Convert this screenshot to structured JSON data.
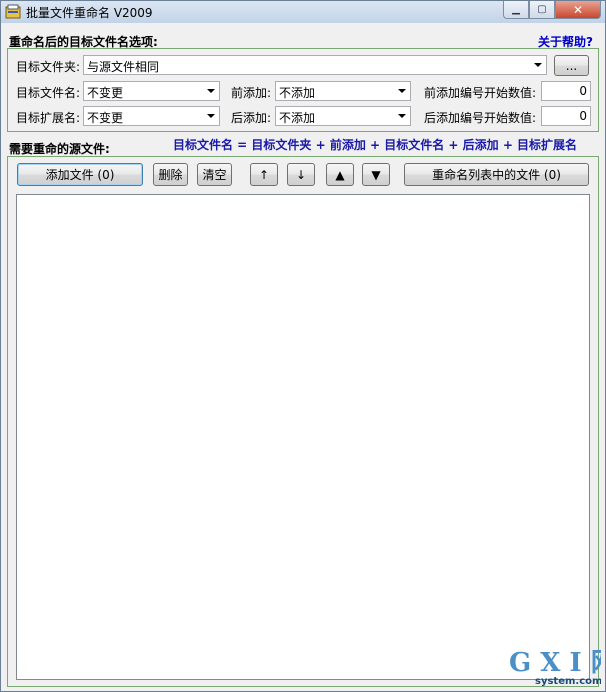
{
  "window": {
    "title": "批量文件重命名 V2009"
  },
  "options": {
    "section_title": "重命名后的目标文件名选项:",
    "help_link": "关于帮助?",
    "target_folder_label": "目标文件夹:",
    "target_folder_value": "与源文件相同",
    "browse_label": "...",
    "target_name_label": "目标文件名:",
    "target_name_value": "不变更",
    "target_ext_label": "目标扩展名:",
    "target_ext_value": "不变更",
    "prefix_label": "前添加:",
    "prefix_value": "不添加",
    "suffix_label": "后添加:",
    "suffix_value": "不添加",
    "prefix_start_label": "前添加编号开始数值:",
    "prefix_start_value": "0",
    "suffix_start_label": "后添加编号开始数值:",
    "suffix_start_value": "0"
  },
  "source": {
    "section_title": "需要重命的源文件:",
    "formula": "目标文件名 = 目标文件夹 +  前添加 + 目标文件名 + 后添加 + 目标扩展名",
    "add_files_label": "添加文件 (0)",
    "delete_label": "删除",
    "clear_label": "清空",
    "move_up_label": "↑",
    "move_down_label": "↓",
    "move_top_label": "▲",
    "move_bottom_label": "▼",
    "rename_label": "重命名列表中的文件 (0)"
  },
  "watermark": {
    "brand": "G X I 网",
    "domain": "system.com"
  }
}
